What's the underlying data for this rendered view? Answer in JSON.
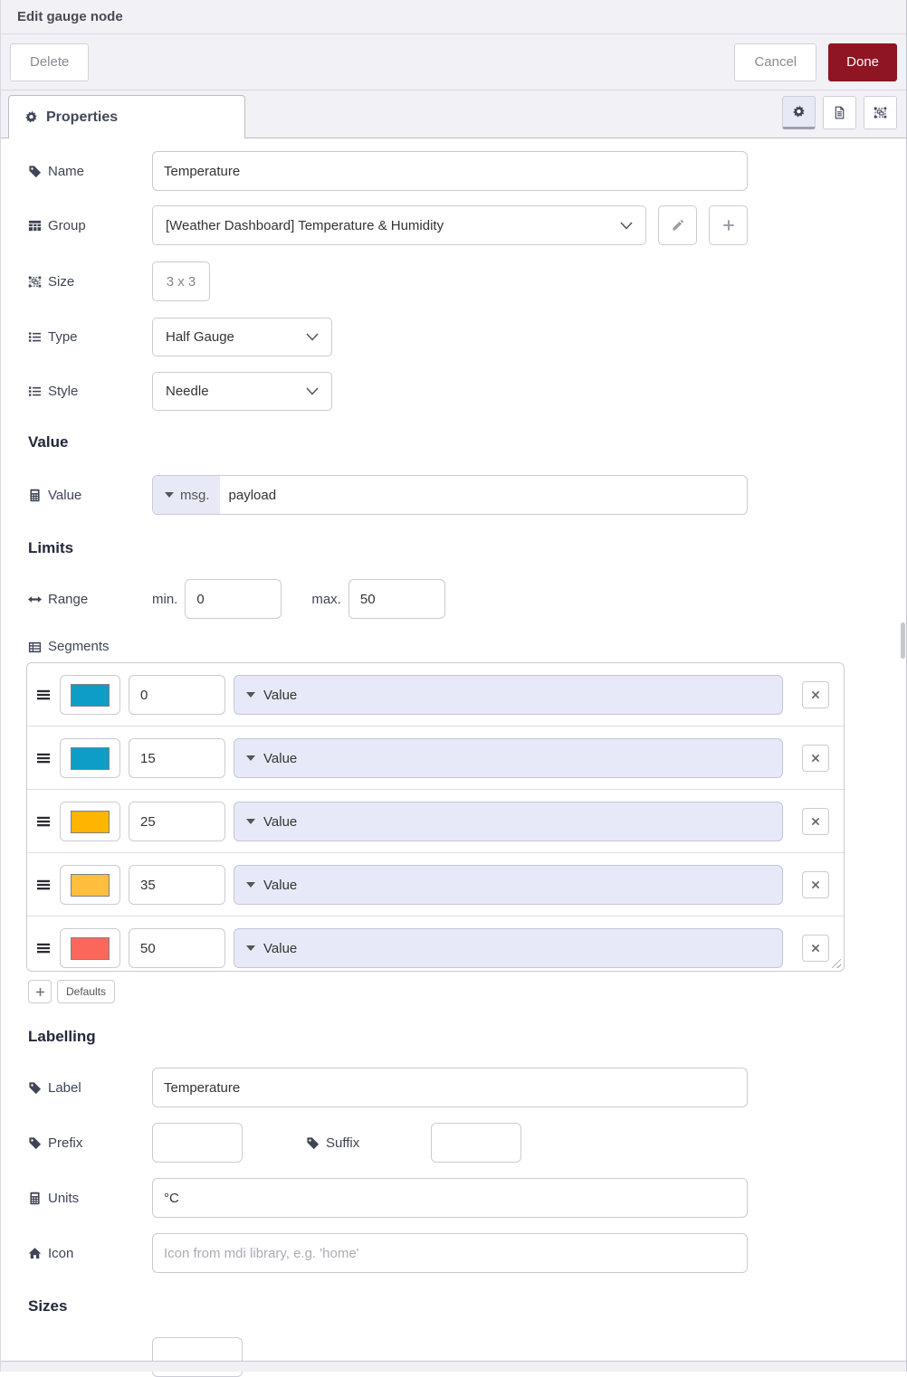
{
  "dialog": {
    "title": "Edit gauge node"
  },
  "actions": {
    "delete": "Delete",
    "cancel": "Cancel",
    "done": "Done"
  },
  "tabs": {
    "properties": {
      "label": "Properties",
      "icon": "gear"
    }
  },
  "tab_buttons": {
    "settings": {
      "icon": "gear",
      "selected": true
    },
    "description": {
      "icon": "file",
      "selected": false
    },
    "appearance": {
      "icon": "object-group",
      "selected": false
    }
  },
  "sections": {
    "value": "Value",
    "limits": "Limits",
    "labelling": "Labelling",
    "sizes": "Sizes"
  },
  "fields": {
    "name": {
      "label": "Name",
      "icon": "tag",
      "value": "Temperature"
    },
    "group": {
      "label": "Group",
      "icon": "table",
      "value": "[Weather Dashboard] Temperature & Humidity"
    },
    "size": {
      "label": "Size",
      "icon": "object-group",
      "value": "3 x 3"
    },
    "type": {
      "label": "Type",
      "icon": "list",
      "value": "Half Gauge"
    },
    "style": {
      "label": "Style",
      "icon": "list",
      "value": "Needle"
    },
    "value": {
      "label": "Value",
      "icon": "calculator",
      "prefix": "msg.",
      "value": "payload"
    },
    "range": {
      "label": "Range",
      "icon": "arrows-h",
      "min_label": "min.",
      "min": "0",
      "max_label": "max.",
      "max": "50"
    },
    "label": {
      "label": "Label",
      "icon": "tag",
      "value": "Temperature"
    },
    "prefix": {
      "label": "Prefix",
      "icon": "tag",
      "value": ""
    },
    "suffix": {
      "label": "Suffix",
      "icon": "tag",
      "value": ""
    },
    "units": {
      "label": "Units",
      "icon": "calculator",
      "value": "°C"
    },
    "icon": {
      "label": "Icon",
      "icon": "home",
      "value": "",
      "placeholder": "Icon from mdi library, e.g. 'home'"
    }
  },
  "segments": {
    "label": "Segments",
    "icon": "th-list",
    "rows": [
      {
        "color": "#0D9DC6",
        "pattern": "solid",
        "value": "0",
        "option": "Value"
      },
      {
        "color": "#0D9DC6",
        "pattern": "solid",
        "value": "15",
        "option": "Value"
      },
      {
        "color": "#FFB400",
        "pattern": "solid",
        "value": "25",
        "option": "Value"
      },
      {
        "color": "#FFBE3D",
        "pattern": "dotted",
        "value": "35",
        "option": "Value"
      },
      {
        "color": "#FB685A",
        "pattern": "solid",
        "value": "50",
        "option": "Value"
      }
    ],
    "add_label": "+",
    "defaults_label": "Defaults"
  },
  "theme": {
    "done_button_bg": "#8E1521",
    "header_bg": "#F1F1F6",
    "typed_input_bg": "#E8E9F7",
    "segment_select_bg": "#E7E9F8",
    "swatch_border": "#808088"
  }
}
